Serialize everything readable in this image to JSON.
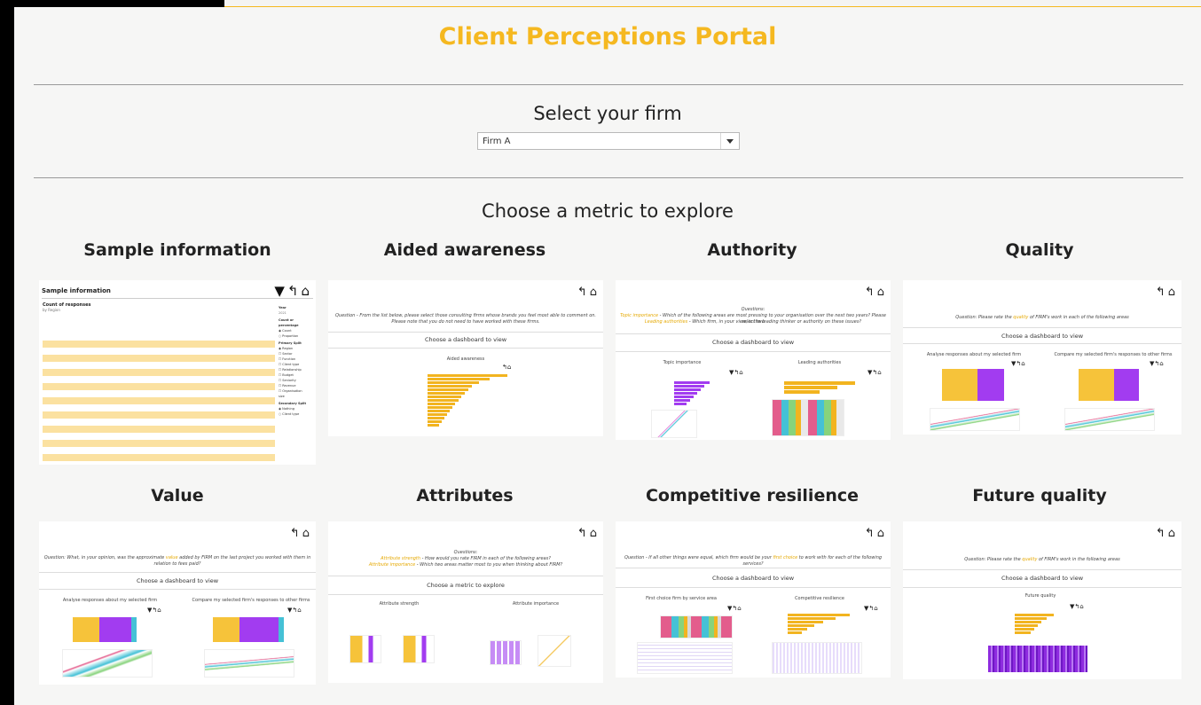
{
  "portal": {
    "title": "Client Perceptions Portal",
    "select_label": "Select your firm",
    "firm_selected": "Firm A",
    "metric_label": "Choose a metric to explore"
  },
  "cards": {
    "sample": {
      "title": "Sample information",
      "thumb_title": "Sample information",
      "count_title": "Count of responses",
      "count_sub": "by Region",
      "side_year": "Year",
      "side_count": "Count or percentage",
      "side_primary": "Primary Split",
      "side_secondary": "Secondary Split"
    },
    "aided": {
      "title": "Aided awareness",
      "question": "Question - From the list below, please select those consulting firms whose brands you feel most able to comment on. Please note that you do not need to have worked with these firms.",
      "choose": "Choose a dashboard to view",
      "chart_caption": "Aided awareness"
    },
    "authority": {
      "title": "Authority",
      "questions_label": "Questions:",
      "question_prefix": "Topic importance",
      "question_text": "- Which of the following areas are most pressing to your organisation over the next two years? Please select two",
      "question_prefix2": "Leading authorities",
      "question_text2": "- Which firm, in your view, is the leading thinker or authority on these issues?",
      "choose": "Choose a dashboard to view",
      "left_caption": "Topic importance",
      "right_caption": "Leading authorities"
    },
    "quality": {
      "title": "Quality",
      "question_pre": "Question: Please rate the",
      "question_hl": "quality",
      "question_post": "of FIRM's work in each of the following areas",
      "choose": "Choose a dashboard to view",
      "left_caption": "Analyse responses about my selected firm",
      "right_caption": "Compare my selected firm's responses to other firms"
    },
    "value": {
      "title": "Value",
      "question_pre": "Question: What, in your opinion, was the approximate",
      "question_hl": "value",
      "question_post": "added by FIRM on the last project you worked with them in relation to fees paid?",
      "choose": "Choose a dashboard to view",
      "left_caption": "Analyse responses about my selected firm",
      "right_caption": "Compare my selected firm's responses to other firms"
    },
    "attributes": {
      "title": "Attributes",
      "questions_label": "Questions:",
      "q1_hl": "Attribute strength",
      "q1": "- How would you rate FIRM in each of the following areas?",
      "q2_hl": "Attribute importance",
      "q2": "- Which two areas matter most to you when thinking about FIRM?",
      "choose": "Choose a metric to explore",
      "left_caption": "Attribute strength",
      "right_caption": "Attribute importance"
    },
    "competitive": {
      "title": "Competitive resilience",
      "question_pre": "Question - If all other things were equal, which firm would be your",
      "question_hl": "first choice",
      "question_post": "to work with for each of the following services?",
      "choose": "Choose a dashboard to view",
      "left_caption": "First choice firm by service area",
      "right_caption": "Competitive resilience"
    },
    "future": {
      "title": "Future quality",
      "question_pre": "Question: Please rate the",
      "question_hl": "quality",
      "question_post": "of FIRM's work in the following areas",
      "choose": "Choose a dashboard to view",
      "chart_caption": "Future quality"
    }
  },
  "icons": {
    "back": "↰",
    "home": "⌂",
    "filter": "▼"
  },
  "colors": {
    "accent": "#f5b820",
    "purple": "#a23cf0",
    "cyan": "#45c1d6"
  }
}
